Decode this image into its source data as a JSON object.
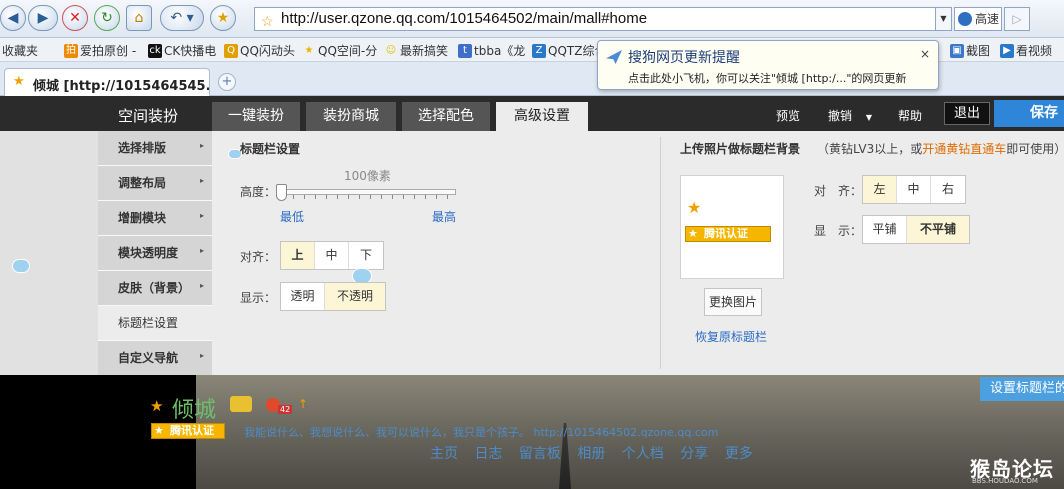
{
  "browser": {
    "address_url": "http://user.qzone.qq.com/1015464502/main/mall#home",
    "speed_label": "高速",
    "tab_title": "倾城 [http://1015464545...",
    "new_tab_symbol": "+"
  },
  "favorites": [
    {
      "label": "收藏夹",
      "color": "#e8b400"
    },
    {
      "label": "爱拍原创 -",
      "color": "#f08a00"
    },
    {
      "label": "CK快播电",
      "color": "#111111"
    },
    {
      "label": "QQ闪动头",
      "color": "#e0a000"
    },
    {
      "label": "QQ空间-分",
      "color": "#f0b400"
    },
    {
      "label": "最新搞笑",
      "color": "#e0c000"
    },
    {
      "label": "tbba《龙",
      "color": "#3f6fc8"
    },
    {
      "label": "QQTZ综合",
      "color": "#2a78c8"
    },
    {
      "label": "截图",
      "color": "#3c78c8"
    },
    {
      "label": "看视频",
      "color": "#2a78c8"
    }
  ],
  "popup": {
    "title": "搜狗网页更新提醒",
    "text": "点击此处小飞机，你可以关注\"倾城 [http:/...\"的网页更新",
    "close": "×"
  },
  "header": {
    "title": "空间装扮",
    "tabs": [
      "一键装扮",
      "装扮商城",
      "选择配色",
      "高级设置"
    ],
    "active_tab": 3,
    "preview": "预览",
    "undo": "撤销",
    "help": "帮助",
    "exit": "退出",
    "save": "保存"
  },
  "menu": [
    {
      "label": "选择排版",
      "arrow": "▸"
    },
    {
      "label": "调整布局",
      "arrow": "▸"
    },
    {
      "label": "增删模块",
      "arrow": "▸"
    },
    {
      "label": "模块透明度",
      "arrow": "▸"
    },
    {
      "label": "皮肤（背景）",
      "arrow": "▸"
    },
    {
      "label": "标题栏设置",
      "arrow": ""
    },
    {
      "label": "自定义导航",
      "arrow": "▸"
    }
  ],
  "titlebar": {
    "section_title": "标题栏设置",
    "height_label": "高度：",
    "height_value": "100像素",
    "min_label": "最低",
    "max_label": "最高",
    "height_fraction": 0,
    "align_label": "对齐：",
    "align_options": [
      "上",
      "中",
      "下"
    ],
    "align_selected": 0,
    "display_label": "显示：",
    "display_options": [
      "透明",
      "不透明"
    ],
    "display_selected": 1
  },
  "upload": {
    "section_title": "上传照片做标题栏背景",
    "note_prefix": "（黄钻LV3以上，或",
    "note_link": "开通黄钻直通车",
    "note_suffix": "即可使用）",
    "badge": "腾讯认证",
    "change_button": "更换图片",
    "restore_link": "恢复原标题栏",
    "align_label": "对　齐：",
    "align_options": [
      "左",
      "中",
      "右"
    ],
    "align_selected": 0,
    "display_label": "显　示：",
    "display_options": [
      "平铺",
      "不平铺"
    ],
    "display_selected": 1
  },
  "page_preview": {
    "set_titlebar_button": "设置标题栏的",
    "site_name": "倾城",
    "badge": "腾讯认证",
    "level_badge": "42",
    "motto": "我能说什么、我想说什么、我可以说什么，我只是个孩子。 http://1015464502.qzone.qq.com",
    "nav": [
      "主页",
      "日志",
      "留言板",
      "相册",
      "个人档",
      "分享",
      "更多"
    ],
    "watermark": "猴岛论坛",
    "watermark_sub": "BBS.HOUDAO.COM"
  },
  "colors": {
    "header_bg": "#2b2b2b",
    "accent_blue": "#2f86d9",
    "link_orange": "#e06b00",
    "badge_yellow": "#f6b600"
  }
}
